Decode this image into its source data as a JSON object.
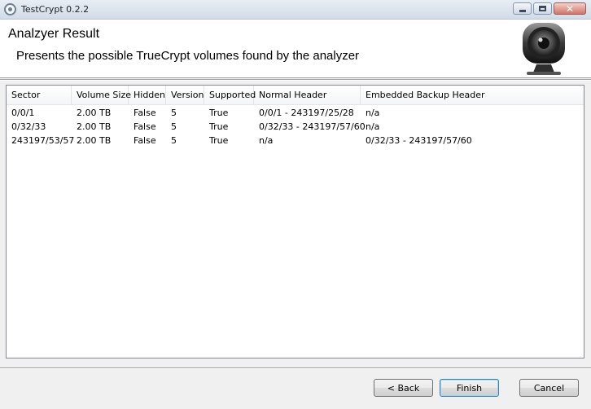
{
  "window": {
    "title": "TestCrypt 0.2.2"
  },
  "header": {
    "title": "Analzyer Result",
    "subtitle": "Presents the possible TrueCrypt volumes found by the analyzer"
  },
  "table": {
    "columns": [
      "Sector",
      "Volume Size",
      "Hidden",
      "Version",
      "Supported",
      "Normal Header",
      "Embedded Backup Header"
    ],
    "rows": [
      [
        "0/0/1",
        "2.00 TB",
        "False",
        "5",
        "True",
        "0/0/1 - 243197/25/28",
        "n/a"
      ],
      [
        "0/32/33",
        "2.00 TB",
        "False",
        "5",
        "True",
        "0/32/33 - 243197/57/60",
        "n/a"
      ],
      [
        "243197/53/57",
        "2.00 TB",
        "False",
        "5",
        "True",
        "n/a",
        "0/32/33 - 243197/57/60"
      ]
    ]
  },
  "buttons": {
    "back": "< Back",
    "finish": "Finish",
    "cancel": "Cancel"
  },
  "icons": {
    "app": "app-lock-icon",
    "logo": "webcam-logo-icon",
    "minimize": "minimize-icon",
    "maximize": "maximize-icon",
    "close": "close-icon"
  }
}
